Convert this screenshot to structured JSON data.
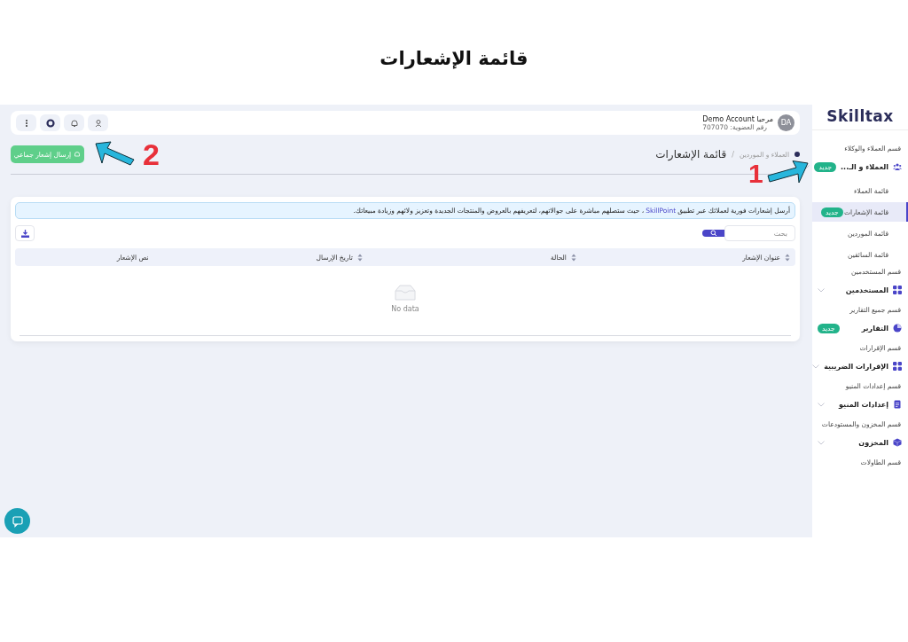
{
  "page_title": "قائمة الإشعارات",
  "annotations": [
    {
      "number": "1"
    },
    {
      "number": "2"
    }
  ],
  "header": {
    "greeting": "مرحبا Demo Account",
    "membership": "رقم العضوية: 707070",
    "avatar": "DA"
  },
  "breadcrumb": {
    "parent": "العملاء و الموردين",
    "separator": "/",
    "current": "قائمة الإشعارات"
  },
  "send_button": "إرسال إشعار جماعي",
  "banner": {
    "before": "أرسل إشعارات فورية لعملائك عبر تطبيق",
    "link": "SkillPoint",
    "after": "، حيث ستصلهم مباشرة على جوالاتهم، لتعريفهم بالعروض والمنتجات الجديدة وتعزيز ولائهم وزيادة مبيعاتك."
  },
  "search": {
    "placeholder": "بحث"
  },
  "table": {
    "columns": [
      "عنوان الإشعار",
      "الحالة",
      "تاريخ الإرسال",
      "نص الإشعار"
    ],
    "empty_text": "No data"
  },
  "sidebar": {
    "logo": "Skilltax",
    "sections": [
      {
        "label": "قسم العملاء والوكلاء",
        "item": {
          "label": "العملاء و الـ...",
          "badge": "جديد",
          "expandable": true,
          "children": [
            {
              "label": "قائمة العملاء",
              "selected": false
            },
            {
              "label": "قائمة الإشعارات",
              "selected": true,
              "badge": "جديد"
            },
            {
              "label": "قائمة الموردين",
              "selected": false
            },
            {
              "label": "قائمة السائقين",
              "selected": false
            }
          ]
        }
      },
      {
        "label": "قسم المستخدمين",
        "item": {
          "label": "المستخدمين",
          "expandable": true
        }
      },
      {
        "label": "قسم جميع التقارير",
        "item": {
          "label": "التقارير",
          "badge": "جديد",
          "expandable": false
        }
      },
      {
        "label": "قسم الإقرارات",
        "item": {
          "label": "الإقرارات الضريبية",
          "expandable": true
        }
      },
      {
        "label": "قسم إعدادات المنيو",
        "item": {
          "label": "إعدادات المنيو",
          "expandable": true
        }
      },
      {
        "label": "قسم المخزون والمستودعات",
        "item": {
          "label": "المخزون",
          "expandable": true
        }
      },
      {
        "label": "قسم الطاولات"
      }
    ]
  }
}
